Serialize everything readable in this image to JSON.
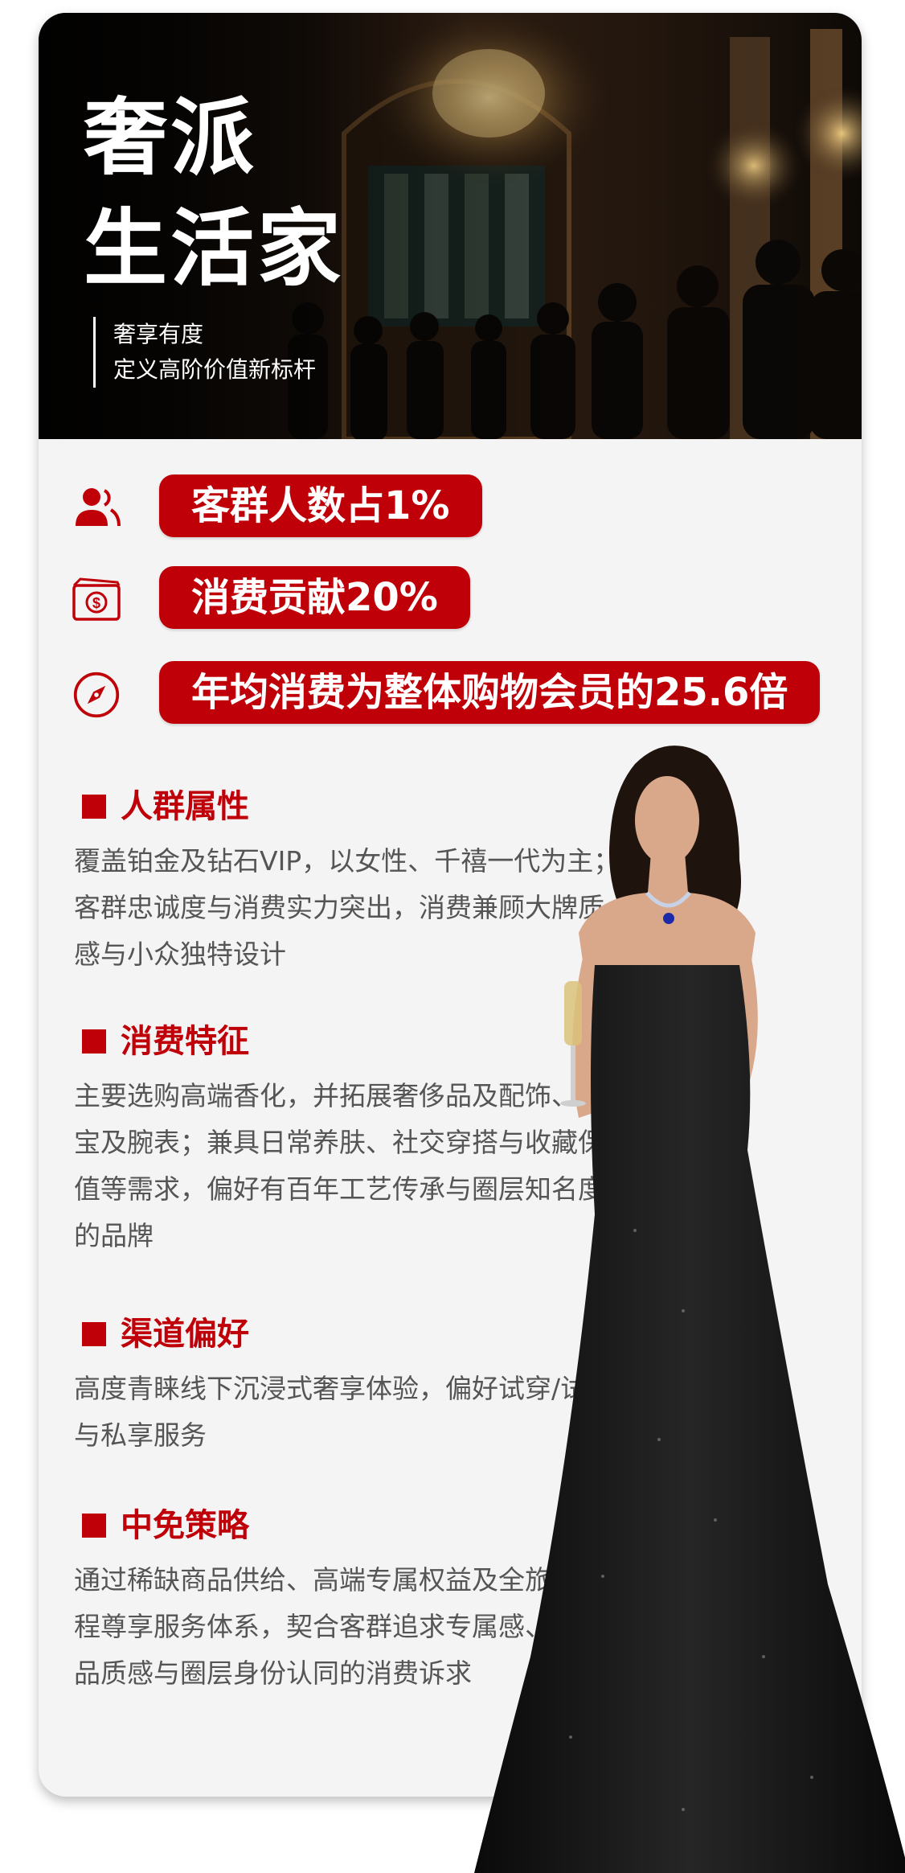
{
  "hero": {
    "title_line1": "奢派",
    "title_line2": "生活家",
    "subtitle_line1": "奢享有度",
    "subtitle_line2": "定义高阶价值新标杆"
  },
  "stats": [
    {
      "icon": "users-icon",
      "label": "客群人数占1%"
    },
    {
      "icon": "money-icon",
      "label": "消费贡献20%"
    },
    {
      "icon": "compass-icon",
      "label": "年均消费为整体购物会员的25.6倍"
    }
  ],
  "sections": [
    {
      "title": "人群属性",
      "body": "覆盖铂金及钻石VIP，以女性、千禧一代为主；客群忠诚度与消费实力突出，消费兼顾大牌质感与小众独特设计"
    },
    {
      "title": "消费特征",
      "body": "主要选购高端香化，并拓展奢侈品及配饰、珠宝及腕表；兼具日常养肤、社交穿搭与收藏保值等需求，偏好有百年工艺传承与圈层知名度的品牌"
    },
    {
      "title": "渠道偏好",
      "body": "高度青睐线下沉浸式奢享体验，偏好试穿/试戴与私享服务"
    },
    {
      "title": "中免策略",
      "body": "通过稀缺商品供给、高端专属权益及全旅程尊享服务体系，契合客群追求专属感、品质感与圈层身份认同的消费诉求"
    }
  ],
  "colors": {
    "accent": "#c00008",
    "body_text": "#555555",
    "card_bg": "#f4f4f4"
  }
}
